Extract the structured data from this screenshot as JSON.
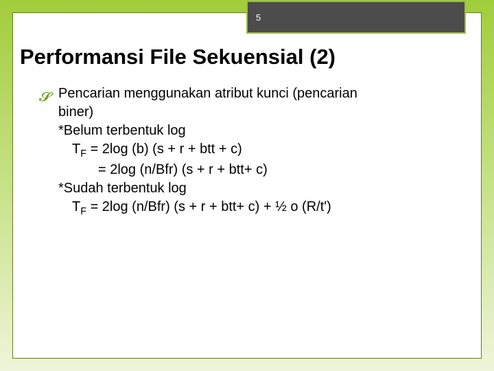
{
  "header": {
    "page_number": "5"
  },
  "slide": {
    "title": "Performansi File Sekuensial (2)",
    "bullet_lead": "Pencarian",
    "bullet_tail": " menggunakan atribut kunci (pencarian",
    "line_biner": "biner)",
    "line_not_log": "*Belum terbentuk log",
    "tf_label_1": "T",
    "tf_sub_1": "F",
    "eq1_rhs": " = 2log (b) (s + r + btt + c)",
    "eq2": "= 2log (n/Bfr) (s + r + btt+ c)",
    "line_has_log": "*Sudah terbentuk log",
    "tf_label_2": "T",
    "tf_sub_2": "F",
    "eq3_rhs": " = 2log (n/Bfr) (s + r + btt+ c) + ½ o (R/t')"
  }
}
